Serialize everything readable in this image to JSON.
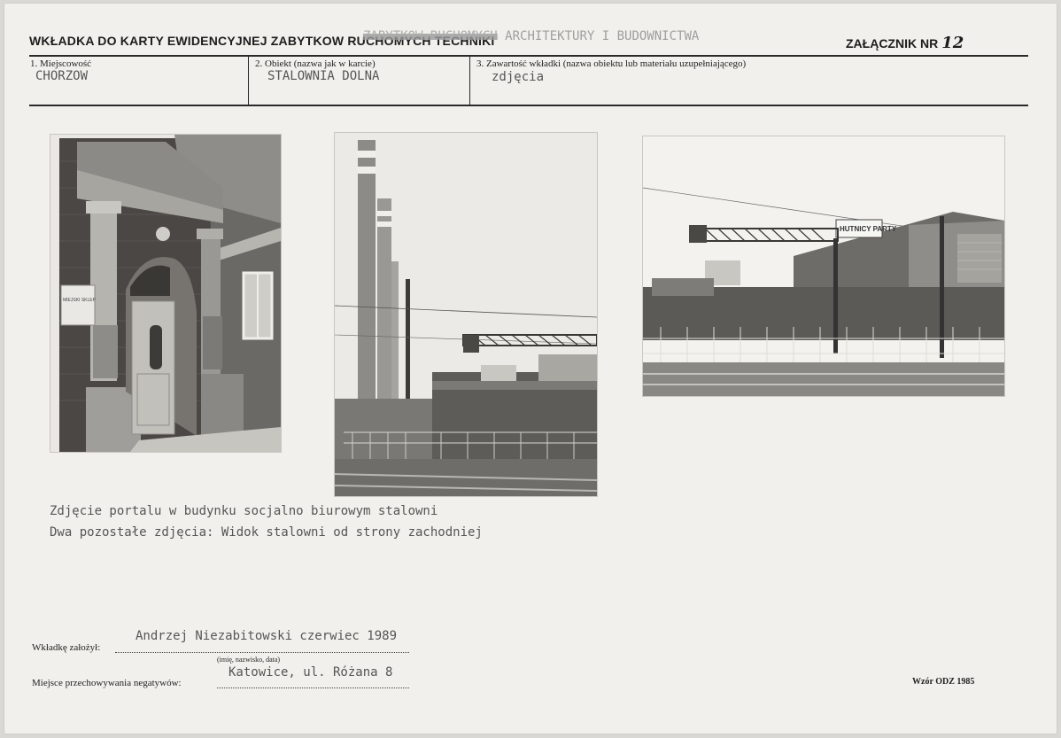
{
  "header": {
    "title": "WKŁADKA DO KARTY EWIDENCYJNEJ ZABYTKOW RUCHOMYCH TECHNIKI",
    "overprint_struck": "ZABYTKOW RUCHOMYCH",
    "overprint_visible": "ARCHITEKTURY I BUDOWNICTWA",
    "attachment_label": "ZAŁĄCZNIK NR",
    "attachment_number": "12"
  },
  "fields": {
    "locality": {
      "label": "1. Miejscowość",
      "value": "CHORZOW"
    },
    "object": {
      "label": "2. Obiekt (nazwa jak w karcie)",
      "value": "STALOWNIA DOLNA"
    },
    "contents": {
      "label": "3. Zawartość wkładki (nazwa obiektu lub materiału uzupełniającego)",
      "value": "zdjęcia"
    }
  },
  "photos": {
    "photo1": {
      "subject": "portal-doorway",
      "sign_text": "MIEJSKI SKLEP"
    },
    "photo2": {
      "subject": "chimneys-and-steelworks"
    },
    "photo3": {
      "subject": "steelworks-west-side",
      "sign_text": "HUTNICY PARTY"
    }
  },
  "captions": {
    "line1": "Zdjęcie portalu w budynku socjalno biurowym stalowni",
    "line2": "Dwa pozostałe zdjęcia: Widok stalowni od strony zachodniej"
  },
  "footer": {
    "created_by_label": "Wkładkę założył:",
    "created_by_value": "Andrzej Niezabitowski czerwiec 1989",
    "created_by_hint": "(imię, nazwisko, data)",
    "negatives_label": "Miejsce przechowywania negatywów:",
    "negatives_value": "Katowice, ul. Różana 8",
    "form_code": "Wzór ODZ 1985"
  }
}
